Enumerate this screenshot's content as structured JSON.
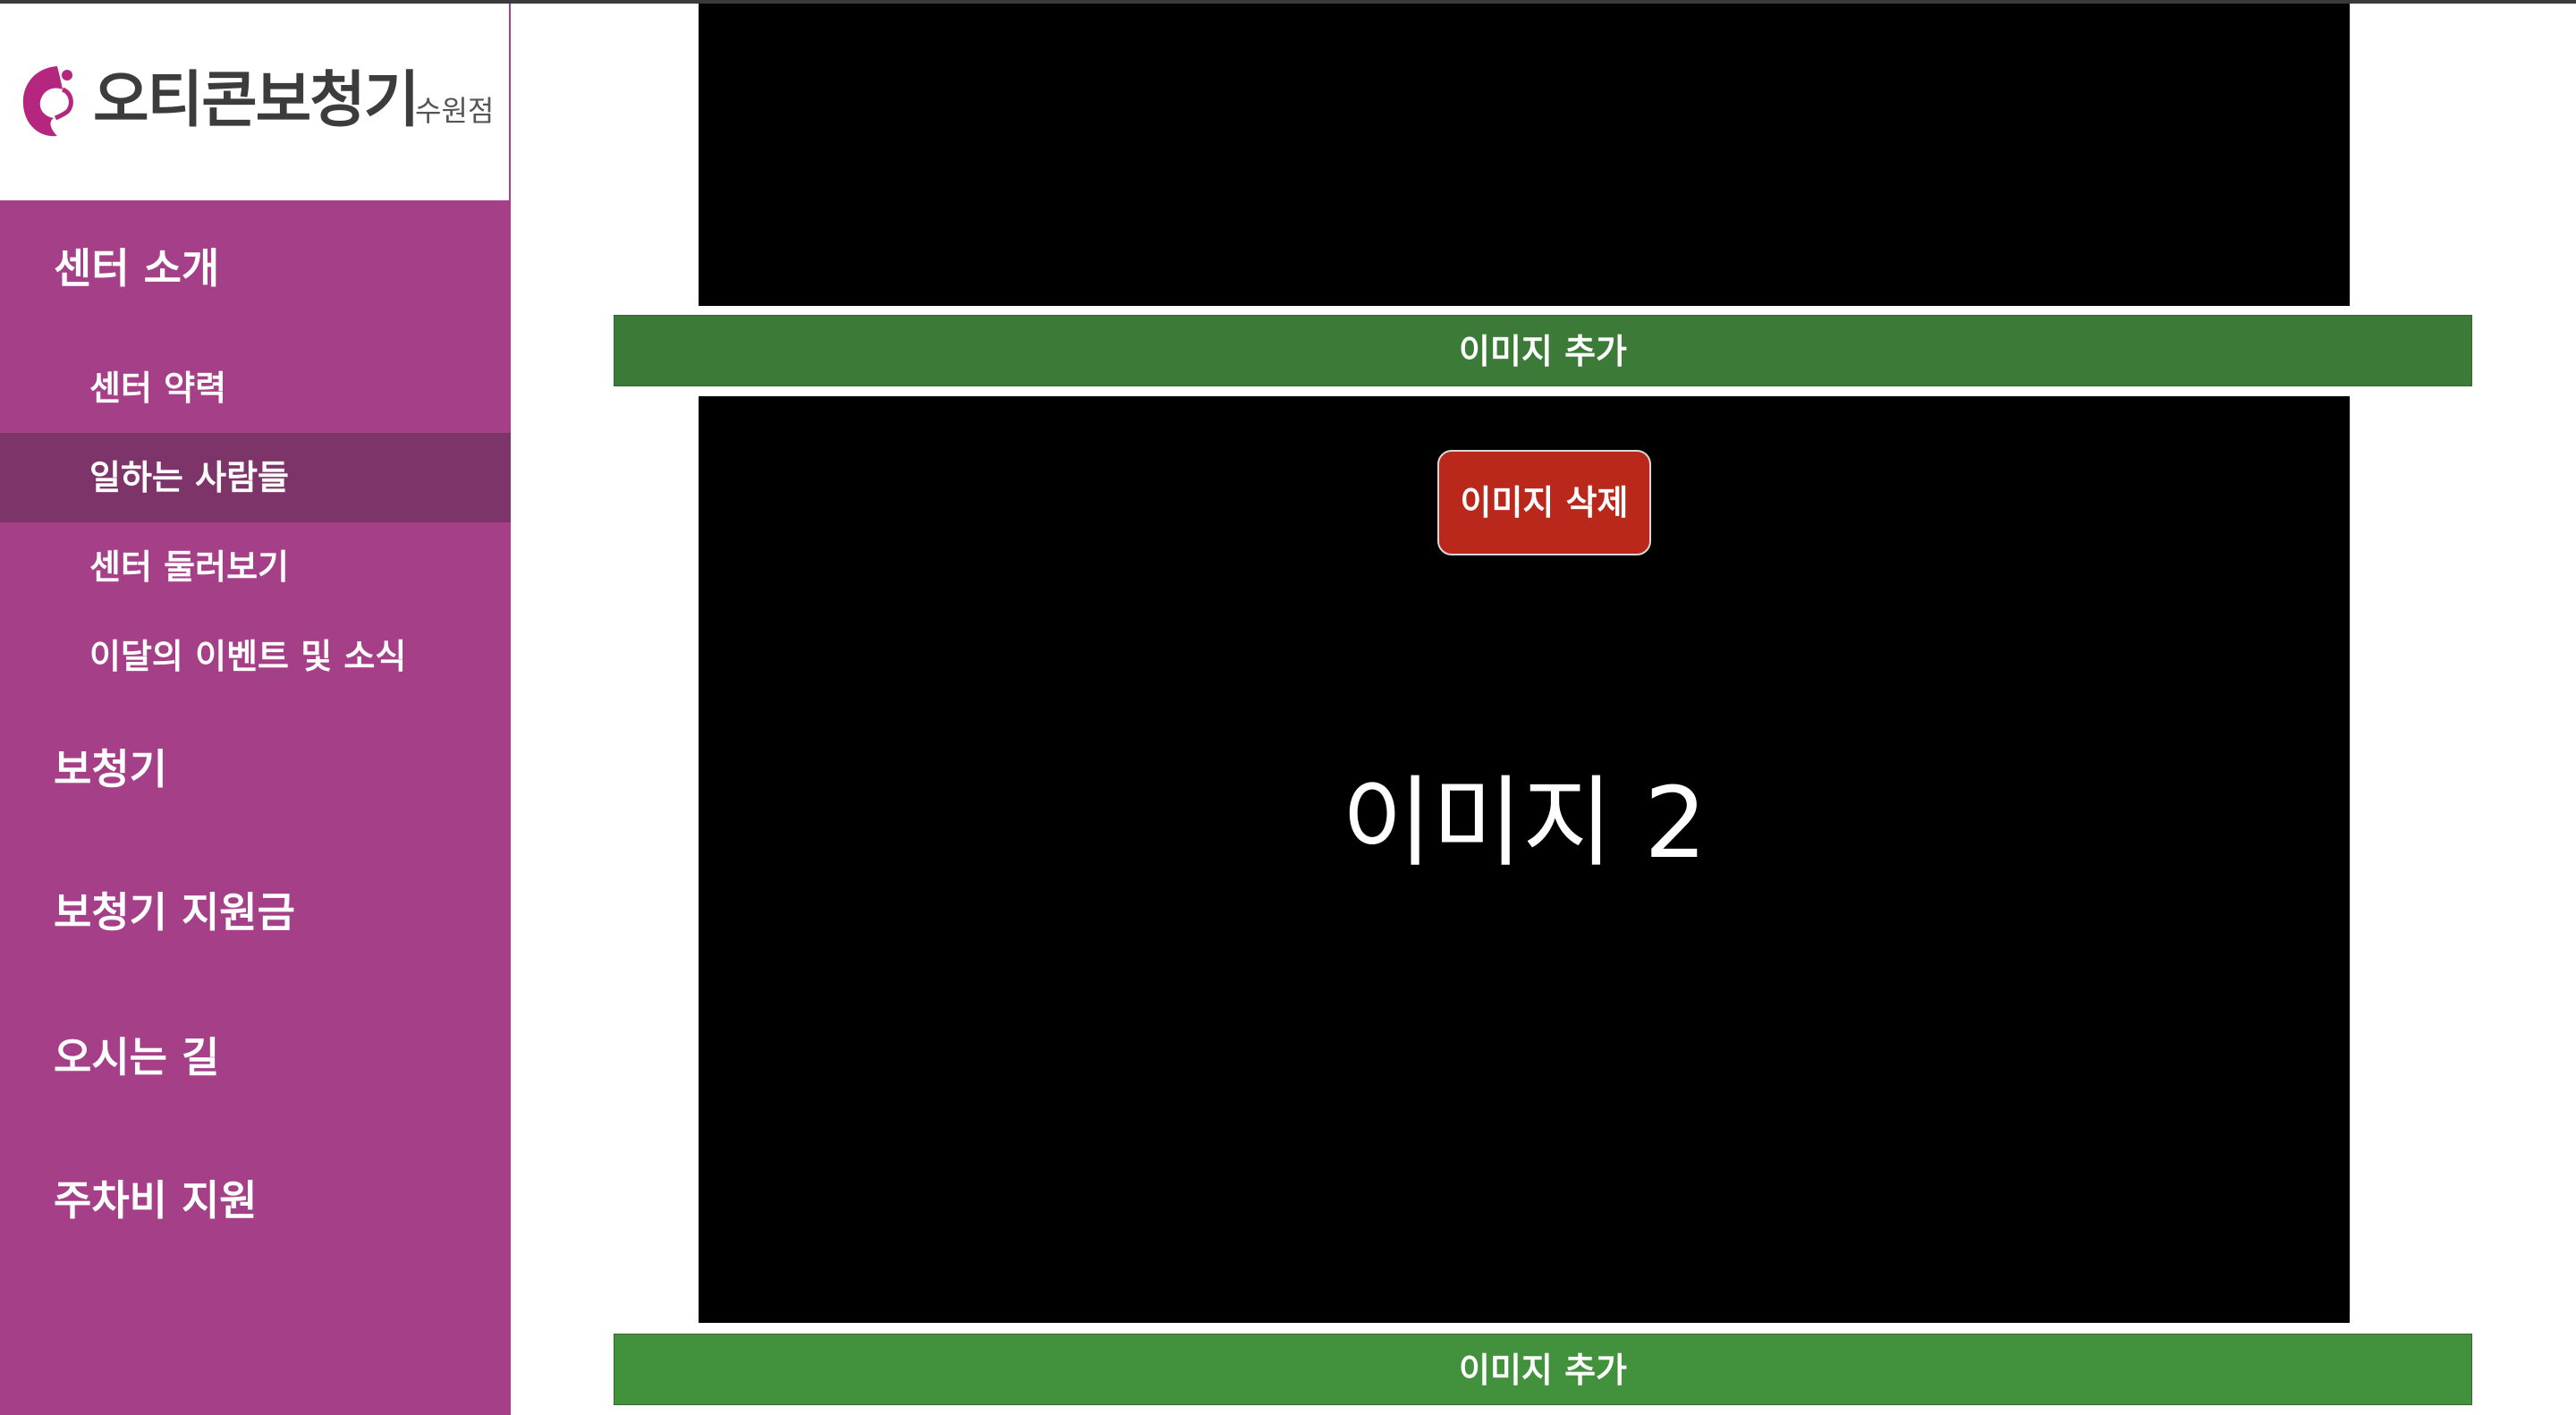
{
  "sidebar": {
    "logo": {
      "title": "오티콘보청기",
      "subtitle": "수원점",
      "icon": "otikon-face-icon",
      "color": "#a43f88"
    },
    "menu": [
      {
        "label": "센터 소개",
        "type": "main"
      },
      {
        "label": "센터 약력",
        "type": "sub"
      },
      {
        "label": "일하는 사람들",
        "type": "sub",
        "active": true
      },
      {
        "label": "센터 둘러보기",
        "type": "sub"
      },
      {
        "label": "이달의 이벤트 및 소식",
        "type": "sub"
      },
      {
        "label": "보청기",
        "type": "main"
      },
      {
        "label": "보청기 지원금",
        "type": "main"
      },
      {
        "label": "오시는 길",
        "type": "main"
      },
      {
        "label": "주차비 지원",
        "type": "main"
      }
    ],
    "bg_color": "#a43f88",
    "active_color": "#7d3468"
  },
  "main": {
    "add_image_top": "이미지 추가",
    "delete_image": "이미지 삭제",
    "image_label": "이미지 2",
    "add_image_bottom": "이미지 추가",
    "add_color": "#3b7b37",
    "delete_color": "#b9281b"
  }
}
